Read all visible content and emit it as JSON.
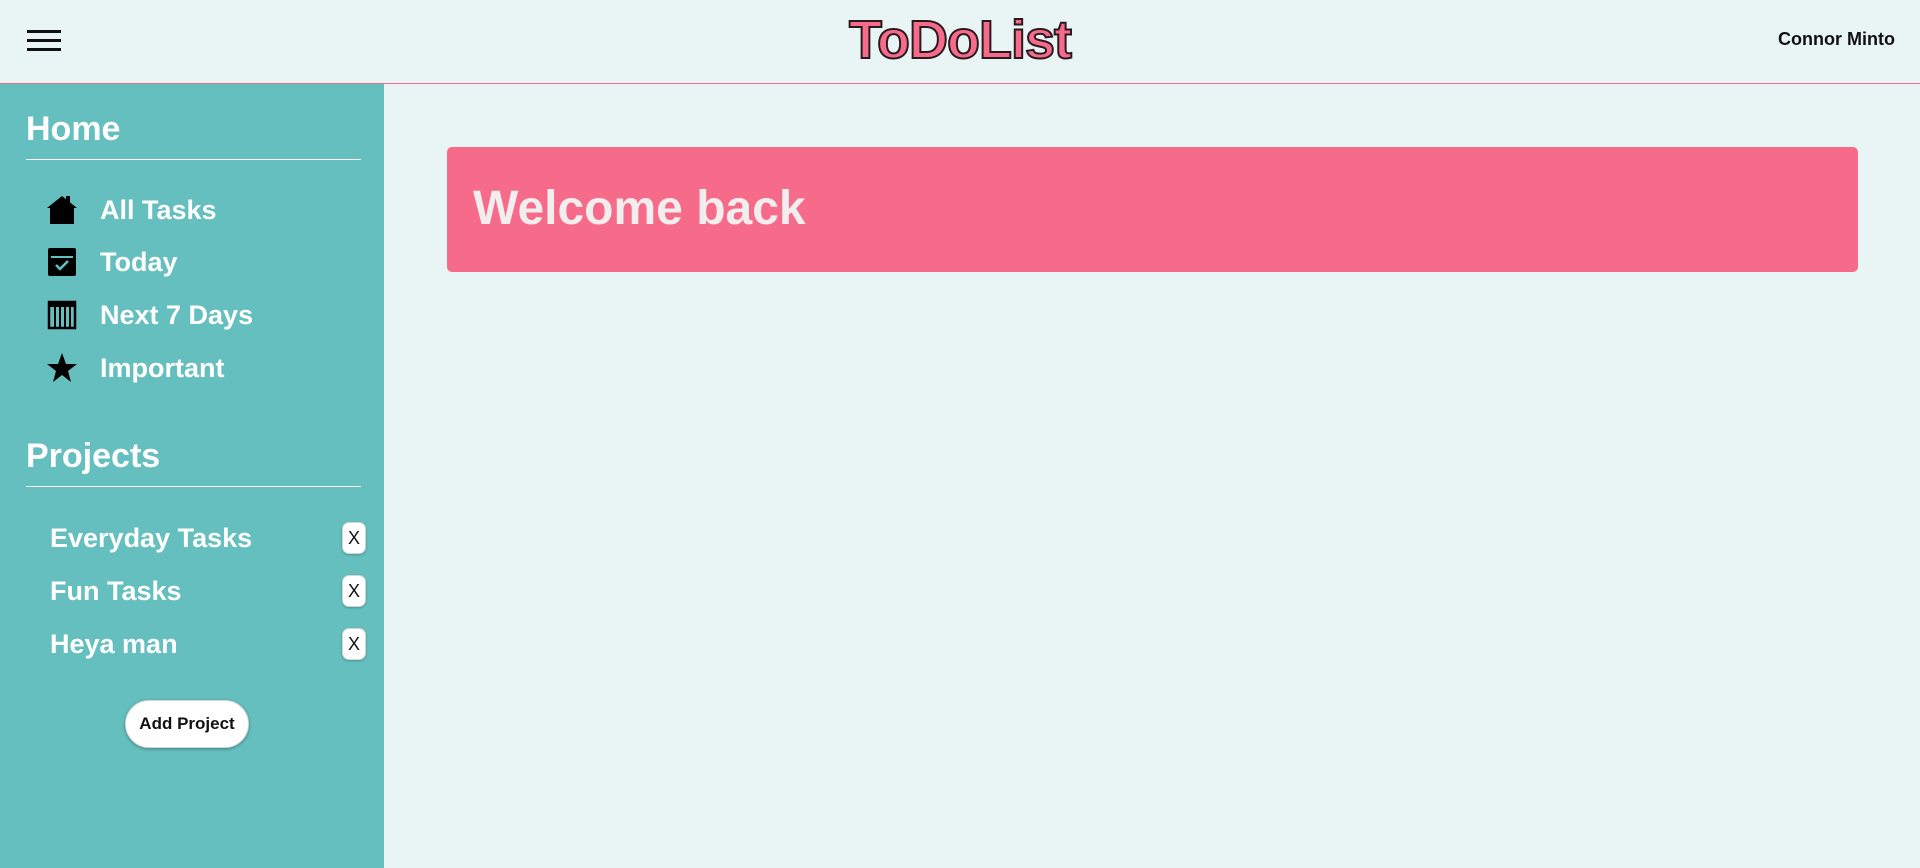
{
  "header": {
    "menu_icon": "hamburger-menu-icon",
    "logo": "ToDoList",
    "user": "Connor Minto"
  },
  "sidebar": {
    "home_title": "Home",
    "nav_items": [
      {
        "label": "All Tasks",
        "icon": "home-icon"
      },
      {
        "label": "Today",
        "icon": "calendar-check-icon"
      },
      {
        "label": "Next 7 Days",
        "icon": "calendar-week-icon"
      },
      {
        "label": "Important",
        "icon": "star-icon"
      }
    ],
    "projects_title": "Projects",
    "projects": [
      {
        "label": "Everyday Tasks",
        "delete_label": "X"
      },
      {
        "label": "Fun Tasks",
        "delete_label": "X"
      },
      {
        "label": "Heya man",
        "delete_label": "X"
      }
    ],
    "add_project_label": "Add Project"
  },
  "main": {
    "welcome_text": "Welcome back"
  },
  "colors": {
    "accent_pink": "#f76b8a",
    "sidebar_teal": "#65bfbf",
    "background": "#e8f5f4"
  }
}
